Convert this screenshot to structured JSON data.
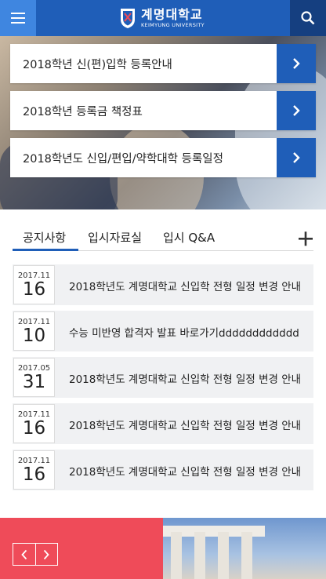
{
  "header": {
    "logo_kr": "계명대학교",
    "logo_en": "KEIMYUNG UNIVERSITY",
    "menu_icon": "hamburger-menu-icon",
    "search_icon": "search-icon",
    "colors": {
      "primary": "#1f5eb8",
      "menu": "#3f86e0",
      "search": "#153f80"
    }
  },
  "quick_links": [
    {
      "label": "2018학년 신(편)입학 등록안내"
    },
    {
      "label": "2018학년 등록금 책정표"
    },
    {
      "label": "2018학년도 신입/편입/약학대학 등록일정"
    }
  ],
  "tabs": [
    {
      "label": "공지사항",
      "active": true
    },
    {
      "label": "입시자료실",
      "active": false
    },
    {
      "label": "입시 Q&A",
      "active": false
    }
  ],
  "more_icon": "plus-icon",
  "news": [
    {
      "date_ym": "2017.11",
      "day": "16",
      "title": "2018학년도 계명대학교 신입학 전형 일정 변경 안내"
    },
    {
      "date_ym": "2017.11",
      "day": "10",
      "title": "수능 미반영 합격자 발표 바로가기dddddddddddd"
    },
    {
      "date_ym": "2017.05",
      "day": "31",
      "title": "2018학년도 계명대학교 신입학 전형 일정 변경 안내"
    },
    {
      "date_ym": "2017.11",
      "day": "16",
      "title": "2018학년도 계명대학교 신입학 전형 일정 변경 안내"
    },
    {
      "date_ym": "2017.11",
      "day": "16",
      "title": "2018학년도 계명대학교 신입학 전형 일정 변경 안내"
    }
  ],
  "banner": {
    "accent": "#ef4b59",
    "prev_icon": "chevron-left-icon",
    "next_icon": "chevron-right-icon"
  }
}
